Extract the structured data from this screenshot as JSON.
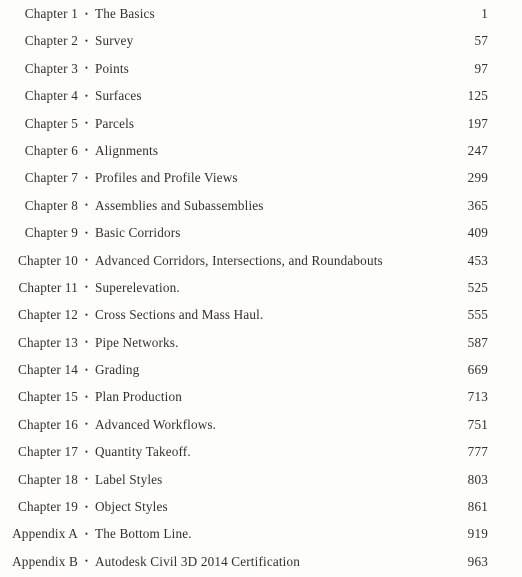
{
  "document": {
    "kind": "book-table-of-contents",
    "bullet_glyph": "•",
    "leader_glyph": ".",
    "text_color": "#33302e",
    "leader_color": "#8d8a86",
    "page_background": "#fdfdfb"
  },
  "entries": [
    {
      "label": "Chapter 1",
      "bullet": "•",
      "title": "The Basics",
      "page": "1",
      "gap": "space"
    },
    {
      "label": "Chapter 2",
      "bullet": "•",
      "title": "Survey",
      "page": "57",
      "gap": "space"
    },
    {
      "label": "Chapter 3",
      "bullet": "•",
      "title": "Points",
      "page": "97",
      "gap": "space"
    },
    {
      "label": "Chapter 4",
      "bullet": "•",
      "title": "Surfaces",
      "page": "125",
      "gap": "space"
    },
    {
      "label": "Chapter 5",
      "bullet": "•",
      "title": "Parcels",
      "page": "197",
      "gap": "space"
    },
    {
      "label": "Chapter 6",
      "bullet": "•",
      "title": "Alignments",
      "page": "247",
      "gap": "space"
    },
    {
      "label": "Chapter 7",
      "bullet": "•",
      "title": "Profiles and Profile Views",
      "page": "299",
      "gap": "none"
    },
    {
      "label": "Chapter 8",
      "bullet": "•",
      "title": "Assemblies and Subassemblies",
      "page": "365",
      "gap": "space"
    },
    {
      "label": "Chapter 9",
      "bullet": "•",
      "title": "Basic Corridors",
      "page": "409",
      "gap": "space"
    },
    {
      "label": "Chapter 10",
      "bullet": "•",
      "title": "Advanced Corridors, Intersections, and Roundabouts",
      "page": "453",
      "gap": "space"
    },
    {
      "label": "Chapter 11",
      "bullet": "•",
      "title": "Superelevation.",
      "page": "525",
      "gap": "none"
    },
    {
      "label": "Chapter 12",
      "bullet": "•",
      "title": "Cross Sections and Mass Haul.",
      "page": "555",
      "gap": "none"
    },
    {
      "label": "Chapter 13",
      "bullet": "•",
      "title": "Pipe Networks.",
      "page": "587",
      "gap": "none"
    },
    {
      "label": "Chapter 14",
      "bullet": "•",
      "title": "Grading",
      "page": "669",
      "gap": "space"
    },
    {
      "label": "Chapter 15",
      "bullet": "•",
      "title": "Plan Production",
      "page": "713",
      "gap": "space"
    },
    {
      "label": "Chapter 16",
      "bullet": "•",
      "title": "Advanced Workflows.",
      "page": "751",
      "gap": "none"
    },
    {
      "label": "Chapter 17",
      "bullet": "•",
      "title": "Quantity Takeoff.",
      "page": "777",
      "gap": "none"
    },
    {
      "label": "Chapter 18",
      "bullet": "•",
      "title": "Label Styles",
      "page": "803",
      "gap": "space"
    },
    {
      "label": "Chapter 19",
      "bullet": "•",
      "title": "Object Styles",
      "page": "861",
      "gap": "space"
    },
    {
      "label": "Appendix A",
      "bullet": "•",
      "title": "The Bottom Line.",
      "page": "919",
      "gap": "none"
    },
    {
      "label": "Appendix B",
      "bullet": "•",
      "title": "Autodesk Civil 3D 2014 Certification",
      "page": "963",
      "gap": "space"
    }
  ]
}
